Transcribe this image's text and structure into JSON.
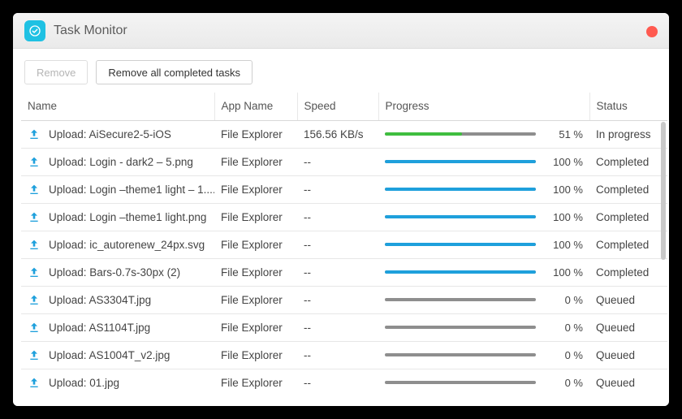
{
  "window": {
    "title": "Task Monitor"
  },
  "toolbar": {
    "remove_label": "Remove",
    "remove_all_label": "Remove all completed tasks"
  },
  "colors": {
    "progress_active": "#3fbe3f",
    "progress_complete": "#1ea0dc",
    "progress_track": "#8e8e8e"
  },
  "columns": {
    "name": "Name",
    "app": "App Name",
    "speed": "Speed",
    "progress": "Progress",
    "status": "Status"
  },
  "tasks": [
    {
      "name": "Upload: AiSecure2-5-iOS",
      "app": "File Explorer",
      "speed": "156.56 KB/s",
      "progress": 51,
      "status": "In progress"
    },
    {
      "name": "Upload: Login - dark2 – 5.png",
      "app": "File Explorer",
      "speed": "--",
      "progress": 100,
      "status": "Completed"
    },
    {
      "name": "Upload: Login –theme1 light – 1....",
      "app": "File Explorer",
      "speed": "--",
      "progress": 100,
      "status": "Completed"
    },
    {
      "name": "Upload: Login –theme1 light.png",
      "app": "File Explorer",
      "speed": "--",
      "progress": 100,
      "status": "Completed"
    },
    {
      "name": "Upload: ic_autorenew_24px.svg",
      "app": "File Explorer",
      "speed": "--",
      "progress": 100,
      "status": "Completed"
    },
    {
      "name": "Upload: Bars-0.7s-30px (2)",
      "app": "File Explorer",
      "speed": "--",
      "progress": 100,
      "status": "Completed"
    },
    {
      "name": "Upload: AS3304T.jpg",
      "app": "File Explorer",
      "speed": "--",
      "progress": 0,
      "status": "Queued"
    },
    {
      "name": "Upload: AS1104T.jpg",
      "app": "File Explorer",
      "speed": "--",
      "progress": 0,
      "status": "Queued"
    },
    {
      "name": "Upload: AS1004T_v2.jpg",
      "app": "File Explorer",
      "speed": "--",
      "progress": 0,
      "status": "Queued"
    },
    {
      "name": "Upload: 01.jpg",
      "app": "File Explorer",
      "speed": "--",
      "progress": 0,
      "status": "Queued"
    }
  ]
}
